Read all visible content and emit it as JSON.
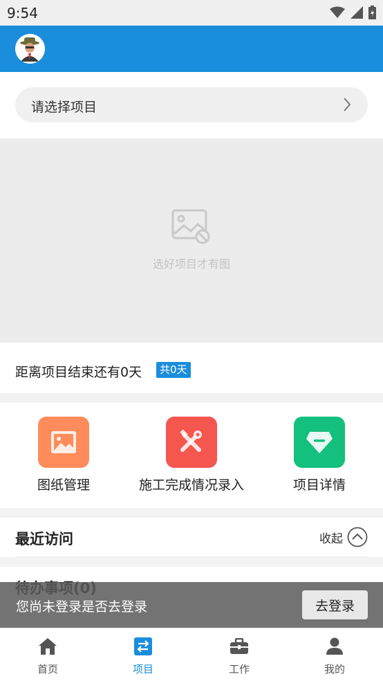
{
  "status_bar": {
    "time": "9:54"
  },
  "selector": {
    "label": "请选择项目"
  },
  "image_area": {
    "placeholder_text": "选好项目才有图"
  },
  "countdown": {
    "text": "距离项目结束还有0天",
    "badge": "共0天"
  },
  "quick_actions": [
    {
      "label": "图纸管理",
      "icon": "picture-icon",
      "color": "#ff8c5a"
    },
    {
      "label": "施工完成情况录入",
      "icon": "tools-icon",
      "color": "#f5564e"
    },
    {
      "label": "项目详情",
      "icon": "diamond-icon",
      "color": "#13c07e"
    }
  ],
  "recent": {
    "title": "最近访问",
    "collapse_label": "收起"
  },
  "todo": {
    "title": "待办事项(0)"
  },
  "login_banner": {
    "text": "您尚未登录是否去登录",
    "button": "去登录"
  },
  "bottom_nav": [
    {
      "label": "首页",
      "icon": "home-icon"
    },
    {
      "label": "项目",
      "icon": "swap-icon",
      "active": true
    },
    {
      "label": "工作",
      "icon": "briefcase-icon"
    },
    {
      "label": "我的",
      "icon": "user-icon"
    }
  ],
  "colors": {
    "primary": "#1a8ddc"
  }
}
